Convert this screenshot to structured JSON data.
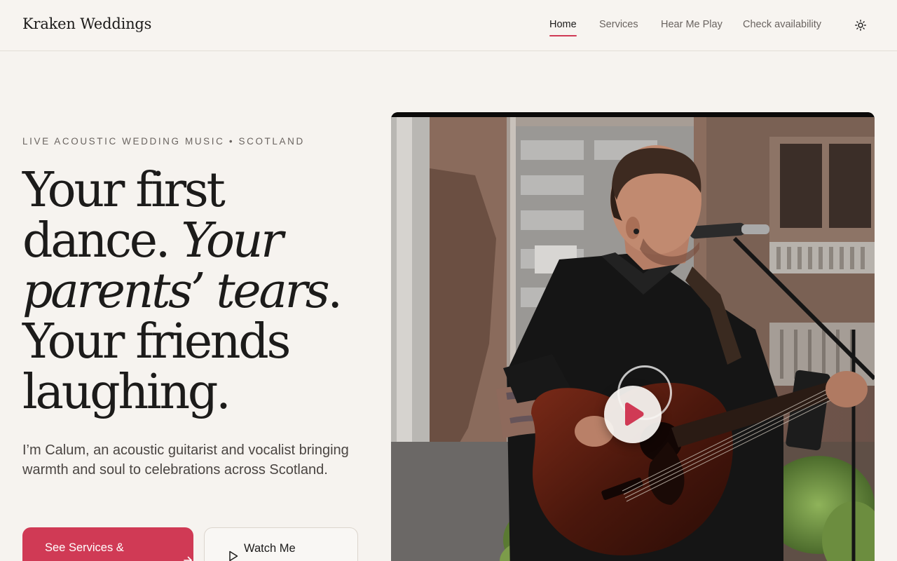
{
  "header": {
    "brand": "Kraken Weddings",
    "nav": [
      {
        "label": "Home",
        "active": true
      },
      {
        "label": "Services",
        "active": false
      },
      {
        "label": "Hear Me Play",
        "active": false
      },
      {
        "label": "Check availability",
        "active": false
      }
    ],
    "theme_toggle_icon": "sun-icon"
  },
  "hero": {
    "eyebrow": "LIVE ACOUSTIC WEDDING MUSIC • SCOTLAND",
    "headline": {
      "line1": "Your first",
      "line2_plain": "dance. ",
      "line2_italic": "Your",
      "line3_italic": "parents’ tears",
      "line3_plain": ".",
      "line4": "Your friends",
      "line5": "laughing."
    },
    "intro": "I’m Calum, an acoustic guitarist and vocalist bringing warmth and soul to celebrations across Scotland.",
    "primary_button": {
      "label": "See Services &",
      "icon": "arrow-right-icon"
    },
    "secondary_button": {
      "label": "Watch Me",
      "icon": "play-outline-icon"
    }
  },
  "video": {
    "play_icon": "play-icon"
  },
  "colors": {
    "accent": "#d03a55",
    "background": "#f6f3ef",
    "text": "#1c1b1a",
    "muted": "#6a6460"
  }
}
